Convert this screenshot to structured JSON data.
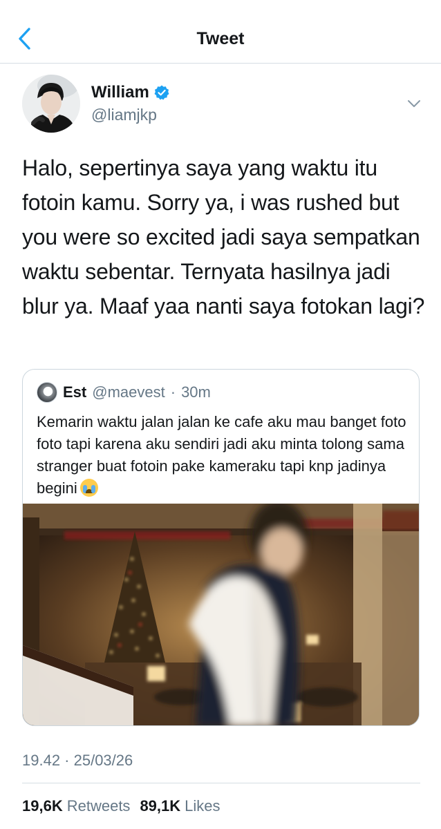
{
  "header": {
    "title": "Tweet",
    "back_icon": "chevron-left-icon",
    "accent_color": "#1da1f2"
  },
  "author": {
    "name": "William",
    "handle": "@liamjkp",
    "verified_icon": "verified-badge-icon",
    "menu_icon": "chevron-down-icon"
  },
  "tweet": {
    "text": "Halo, sepertinya saya yang waktu itu fotoin kamu. Sorry ya, i was rushed but you were so excited jadi saya sempatkan waktu sebentar. Ternyata hasilnya jadi blur ya. Maaf yaa nanti saya fotokan lagi?"
  },
  "quoted_tweet": {
    "name": "Est",
    "handle": "@maevest",
    "separator": "·",
    "time": "30m",
    "text": "Kemarin waktu jalan jalan ke cafe aku mau banget foto foto tapi karena aku sendiri jadi aku minta tolong sama stranger buat fotoin pake kameraku tapi knp jadinya begini",
    "emoji": "loudly-crying-face-emoji",
    "photo": "blurred-photo-hotel-lobby-christmas-tree"
  },
  "meta": {
    "timestamp": "19.42 · 25/03/26",
    "retweets_value": "19,6K",
    "retweets_label": "Retweets",
    "likes_value": "89,1K",
    "likes_label": "Likes"
  }
}
